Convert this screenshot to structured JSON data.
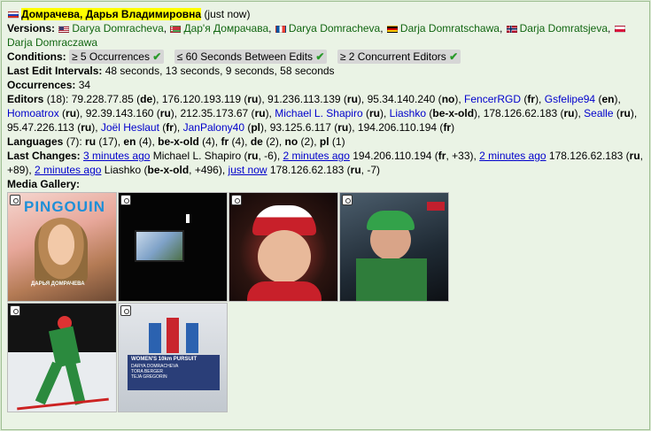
{
  "header": {
    "title": "Домрачева, Дарья Владимировна",
    "time": "(just now)"
  },
  "versions": {
    "label": "Versions:",
    "items": [
      {
        "flag": "us",
        "name": "Darya Domracheva"
      },
      {
        "flag": "by",
        "name": "Дар'я Домрачава"
      },
      {
        "flag": "fr",
        "name": "Darya Domracheva"
      },
      {
        "flag": "de",
        "name": "Darja Domratschawa"
      },
      {
        "flag": "no",
        "name": "Darja Domratsjeva"
      },
      {
        "flag": "pl",
        "name": "Darja Domraczawa"
      }
    ]
  },
  "conditions": {
    "label": "Conditions:",
    "items": [
      "≥ 5 Occurrences",
      "≤ 60 Seconds Between Edits",
      "≥ 2 Concurrent Editors"
    ],
    "check": "✔"
  },
  "intervals": {
    "label": "Last Edit Intervals:",
    "text": "48 seconds, 13 seconds, 9 seconds, 58 seconds"
  },
  "occurrences": {
    "label": "Occurrences:",
    "value": "34"
  },
  "editors": {
    "label": "Editors",
    "count": "(18):",
    "list": [
      {
        "name": "79.228.77.85",
        "lang": "de",
        "link": false
      },
      {
        "name": "176.120.193.119",
        "lang": "ru",
        "link": false
      },
      {
        "name": "91.236.113.139",
        "lang": "ru",
        "link": false
      },
      {
        "name": "95.34.140.240",
        "lang": "no",
        "link": false
      },
      {
        "name": "FencerRGD",
        "lang": "fr",
        "link": true
      },
      {
        "name": "Gsfelipe94",
        "lang": "en",
        "link": true
      },
      {
        "name": "Homoatrox",
        "lang": "ru",
        "link": true
      },
      {
        "name": "92.39.143.160",
        "lang": "ru",
        "link": false
      },
      {
        "name": "212.35.173.67",
        "lang": "ru",
        "link": false
      },
      {
        "name": "Michael L. Shapiro",
        "lang": "ru",
        "link": true
      },
      {
        "name": "Liashko",
        "lang": "be-x-old",
        "link": true
      },
      {
        "name": "178.126.62.183",
        "lang": "ru",
        "link": false
      },
      {
        "name": "Sealle",
        "lang": "ru",
        "link": true
      },
      {
        "name": "95.47.226.113",
        "lang": "ru",
        "link": false
      },
      {
        "name": "Joël Heslaut",
        "lang": "fr",
        "link": true
      },
      {
        "name": "JanPalony40",
        "lang": "pl",
        "link": true
      },
      {
        "name": "93.125.6.117",
        "lang": "ru",
        "link": false
      },
      {
        "name": "194.206.110.194",
        "lang": "fr",
        "link": false
      }
    ]
  },
  "languages": {
    "label": "Languages",
    "count": "(7):",
    "list": [
      {
        "code": "ru",
        "n": "(17)"
      },
      {
        "code": "en",
        "n": "(4)"
      },
      {
        "code": "be-x-old",
        "n": "(4)"
      },
      {
        "code": "fr",
        "n": "(4)"
      },
      {
        "code": "de",
        "n": "(2)"
      },
      {
        "code": "no",
        "n": "(2)"
      },
      {
        "code": "pl",
        "n": "(1)"
      }
    ]
  },
  "last_changes": {
    "label": "Last Changes:",
    "list": [
      {
        "when": "3 minutes ago",
        "who": "Michael L. Shapiro",
        "lang": "ru",
        "delta": "-6"
      },
      {
        "when": "2 minutes ago",
        "who": "194.206.110.194",
        "lang": "fr",
        "delta": "+33"
      },
      {
        "when": "2 minutes ago",
        "who": "178.126.62.183",
        "lang": "ru",
        "delta": "+89"
      },
      {
        "when": "2 minutes ago",
        "who": "Liashko",
        "lang": "be-x-old",
        "delta": "+496"
      },
      {
        "when": "just now",
        "who": "178.126.62.183",
        "lang": "ru",
        "delta": "-7"
      }
    ]
  },
  "gallery": {
    "label": "Media Gallery:",
    "magazine_title": "PINGOUIN",
    "magazine_name": "ДАРЬЯ ДОМРАЧЕВА",
    "ticker_title": "WOMEN'S 10km PURSUIT",
    "ticker_rows": [
      "DARYA DOMRACHEVA",
      "TORA BERGER",
      "TEJA GREGORIN"
    ]
  },
  "colors": {
    "background": "#d9e8d2",
    "panel": "#eaf3e5",
    "highlight": "#ffff00",
    "version_link": "#116611",
    "link": "#0000cc"
  }
}
